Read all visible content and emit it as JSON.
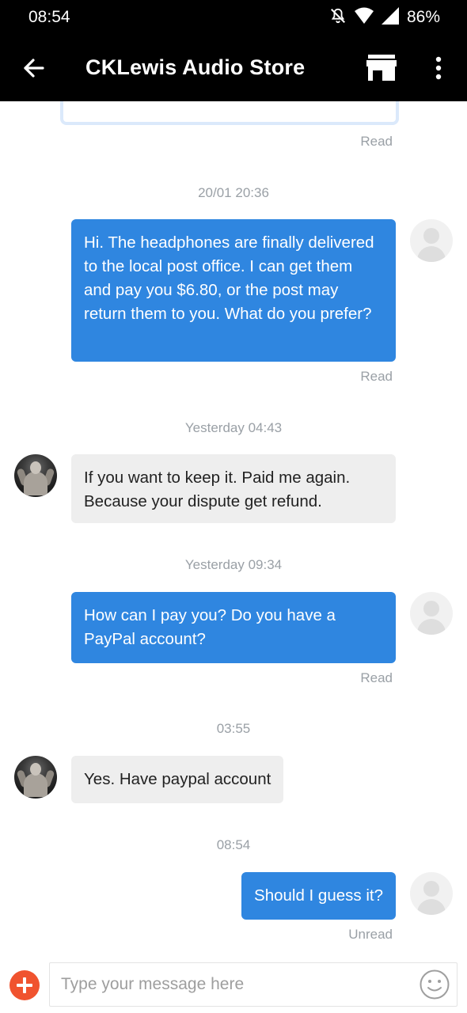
{
  "status_bar": {
    "time": "08:54",
    "battery": "86%",
    "icons": [
      "bell-off-icon",
      "wifi-icon",
      "signal-icon"
    ]
  },
  "app_bar": {
    "title": "CKLewis Audio Store",
    "icons": [
      "back-arrow-icon",
      "store-icon",
      "more-vert-icon"
    ]
  },
  "colors": {
    "outgoing_bubble": "#2f86e0",
    "incoming_bubble": "#eeeeee",
    "add_button": "#f0532f"
  },
  "messages": [
    {
      "read_status": "Read"
    },
    {
      "timestamp": "20/01 20:36",
      "direction": "outgoing",
      "text": "Hi. The headphones are finally delivered to the local post office. I can get them and pay you $6.80, or the post may return them to you. What do you prefer?",
      "read_status": "Read"
    },
    {
      "timestamp": "Yesterday 04:43",
      "direction": "incoming",
      "text": "If you want to keep it. Paid me again. Because your dispute get refund."
    },
    {
      "timestamp": "Yesterday 09:34",
      "direction": "outgoing",
      "text": "How can I pay you? Do you have a PayPal account?",
      "read_status": "Read"
    },
    {
      "timestamp": "03:55",
      "direction": "incoming",
      "text": "Yes. Have paypal account"
    },
    {
      "timestamp": "08:54",
      "direction": "outgoing",
      "text": "Should I guess it?",
      "read_status": "Unread"
    }
  ],
  "input_bar": {
    "placeholder": "Type your message here",
    "value": ""
  }
}
